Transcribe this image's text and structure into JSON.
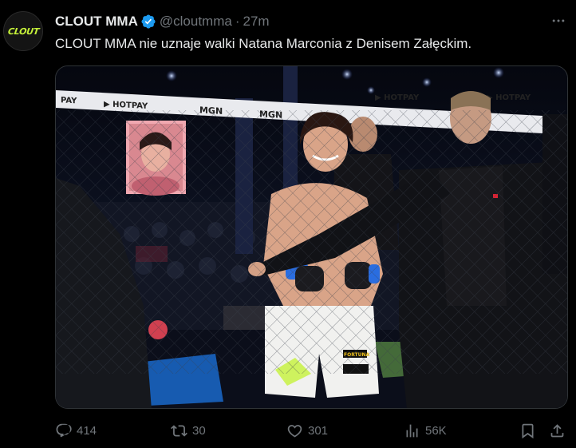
{
  "author": {
    "display_name": "CLOUT MMA",
    "handle": "@cloutmma",
    "time": "27m",
    "separator": "·",
    "avatar_text": "CLOUT",
    "verified": true
  },
  "tweet": {
    "text": "CLOUT MMA nie uznaje walki Natana Marconia z Denisem Załęckim."
  },
  "media": {
    "banner_brands": [
      "HOTPAY",
      "HOTPAY",
      "MGN",
      "MGN",
      "HOTPAY",
      "HOTPAY"
    ],
    "shorts_brand": "FORTUNA",
    "shorts_sub": "EXTREME HOBBY",
    "accent_color": "#c6f23a"
  },
  "actions": {
    "reply_count": "414",
    "retweet_count": "30",
    "like_count": "301",
    "views_count": "56K"
  },
  "icons": {
    "verified": "verified-badge-icon",
    "more": "more-dots-icon",
    "reply": "reply-icon",
    "retweet": "retweet-icon",
    "like": "heart-icon",
    "views": "views-chart-icon",
    "bookmark": "bookmark-icon",
    "share": "share-icon"
  },
  "colors": {
    "background": "#000000",
    "text": "#e7e9ea",
    "muted": "#71767b",
    "verified_blue": "#1d9bf0"
  }
}
